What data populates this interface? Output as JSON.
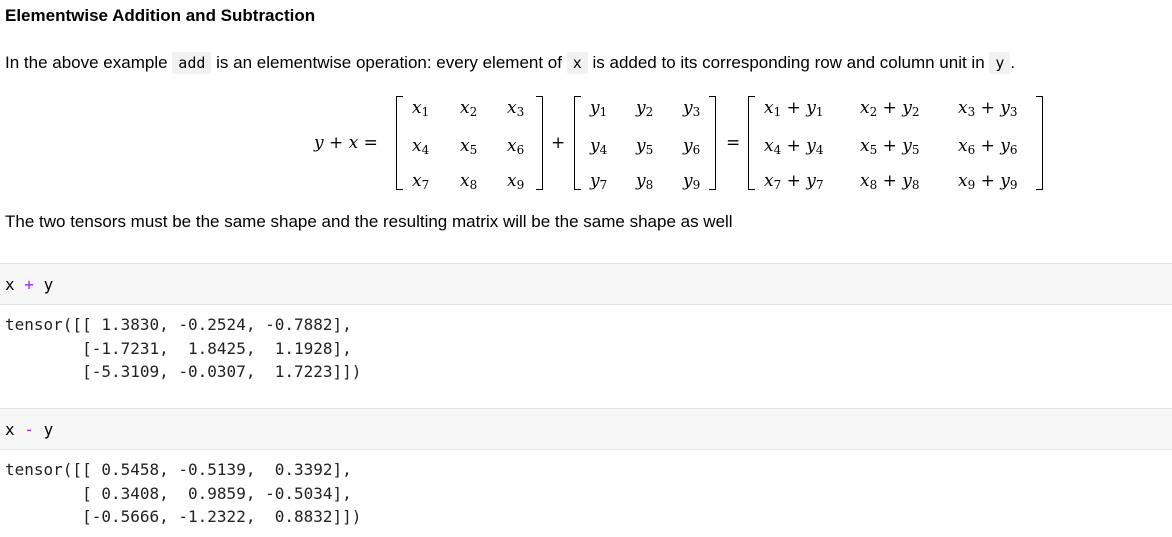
{
  "heading": "Elementwise Addition and Subtraction",
  "para1": {
    "before": "In the above example",
    "code_add": "add",
    "middle": "is an elementwise operation: every element of",
    "code_x": "x",
    "after": "is added to its corresponding row and column unit in",
    "code_y": "y",
    "end": "."
  },
  "equation": {
    "lhs": "y + x =",
    "plus": "+",
    "equals": "=",
    "x_matrix": [
      "x1",
      "x2",
      "x3",
      "x4",
      "x5",
      "x6",
      "x7",
      "x8",
      "x9"
    ],
    "y_matrix": [
      "y1",
      "y2",
      "y3",
      "y4",
      "y5",
      "y6",
      "y7",
      "y8",
      "y9"
    ],
    "sum_matrix": [
      "x1 + y1",
      "x2 + y2",
      "x3 + y3",
      "x4 + y4",
      "x5 + y5",
      "x6 + y6",
      "x7 + y7",
      "x8 + y8",
      "x9 + y9"
    ]
  },
  "para2": "The two tensors must be the same shape and the resulting matrix will be the same shape as well",
  "cells": [
    {
      "input": {
        "left": "x",
        "op": "+",
        "right": "y"
      },
      "output": [
        "tensor([[ 1.3830, -0.2524, -0.7882],",
        "        [-1.7231,  1.8425,  1.1928],",
        "        [-5.3109, -0.0307,  1.7223]])"
      ]
    },
    {
      "input": {
        "left": "x",
        "op": "-",
        "right": "y"
      },
      "output": [
        "tensor([[ 0.5458, -0.5139,  0.3392],",
        "        [ 0.3408,  0.9859, -0.5034],",
        "        [-0.5666, -1.2322,  0.8832]])"
      ]
    }
  ],
  "colors": {
    "operator": "#aa22ff",
    "cell_bg": "#f7f7f7",
    "inline_code_bg": "#f1f1f1"
  }
}
